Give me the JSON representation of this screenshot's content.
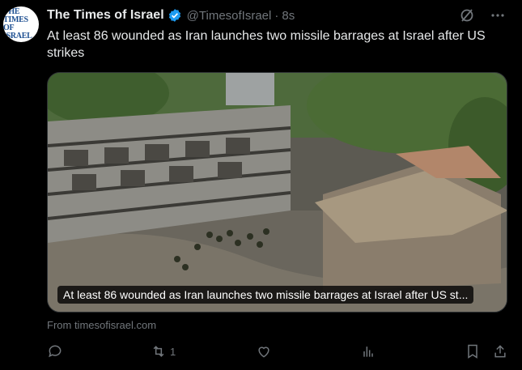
{
  "avatar": {
    "line1": "THE TIMES",
    "line2": "OF ISRAEL"
  },
  "tweet": {
    "author_name": "The Times of Israel",
    "handle": "@TimesofIsrael",
    "separator": "·",
    "time": "8s",
    "text": "At least 86 wounded as Iran launches two missile barrages at Israel after US strikes"
  },
  "card": {
    "caption": "At least 86 wounded as Iran launches two missile barrages at Israel after US st..."
  },
  "source": "From timesofisrael.com",
  "actions": {
    "retweet_count": "1"
  },
  "colors": {
    "background": "#000000",
    "text": "#e7e9ea",
    "secondary": "#71767b",
    "verified": "#1d9bf0"
  },
  "icons": [
    "grok-icon",
    "more-icon",
    "reply-icon",
    "retweet-icon",
    "like-icon",
    "views-icon",
    "bookmark-icon",
    "share-icon",
    "verified-badge-icon"
  ]
}
